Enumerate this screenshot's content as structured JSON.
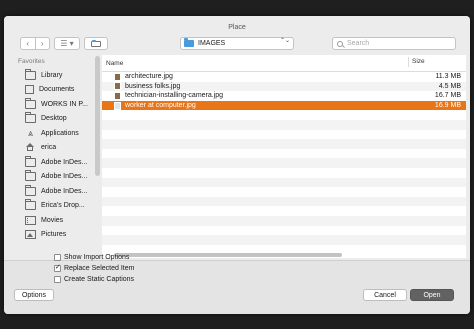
{
  "window": {
    "title": "Place"
  },
  "toolbar": {
    "back_glyph": "‹",
    "forward_glyph": "›",
    "view_glyph": "☰ ▾",
    "path_select": {
      "value": "IMAGES",
      "updown_glyph": "⌃⌄"
    },
    "search": {
      "placeholder": "Search"
    }
  },
  "sidebar": {
    "heading": "Favorites",
    "items": [
      {
        "label": "Library",
        "icon": "folder-icon"
      },
      {
        "label": "Documents",
        "icon": "document-icon"
      },
      {
        "label": "WORKS IN P...",
        "icon": "folder-icon"
      },
      {
        "label": "Desktop",
        "icon": "folder-icon"
      },
      {
        "label": "Applications",
        "icon": "applications-icon"
      },
      {
        "label": "erica",
        "icon": "home-icon"
      },
      {
        "label": "Adobe InDes...",
        "icon": "folder-icon"
      },
      {
        "label": "Adobe InDes...",
        "icon": "folder-icon"
      },
      {
        "label": "Adobe InDes...",
        "icon": "folder-icon"
      },
      {
        "label": "Erica's Drop...",
        "icon": "folder-icon"
      },
      {
        "label": "Movies",
        "icon": "movies-icon"
      },
      {
        "label": "Pictures",
        "icon": "pictures-icon"
      }
    ]
  },
  "filelist": {
    "columns": {
      "name": "Name",
      "size": "Size"
    },
    "files": [
      {
        "name": "architecture.jpg",
        "size": "11.3 MB",
        "selected": false
      },
      {
        "name": "business folks.jpg",
        "size": "4.5 MB",
        "selected": false
      },
      {
        "name": "technician-installing-camera.jpg",
        "size": "16.7 MB",
        "selected": false
      },
      {
        "name": "worker at computer.jpg",
        "size": "16.9 MB",
        "selected": true
      }
    ]
  },
  "options": [
    {
      "label": "Show Import Options",
      "checked": false
    },
    {
      "label": "Replace Selected Item",
      "checked": true
    },
    {
      "label": "Create Static Captions",
      "checked": false
    }
  ],
  "buttons": {
    "options": "Options",
    "cancel": "Cancel",
    "open": "Open"
  },
  "colors": {
    "selection": "#e87517",
    "primary_button": "#626262",
    "folder": "#4a9bdc"
  }
}
